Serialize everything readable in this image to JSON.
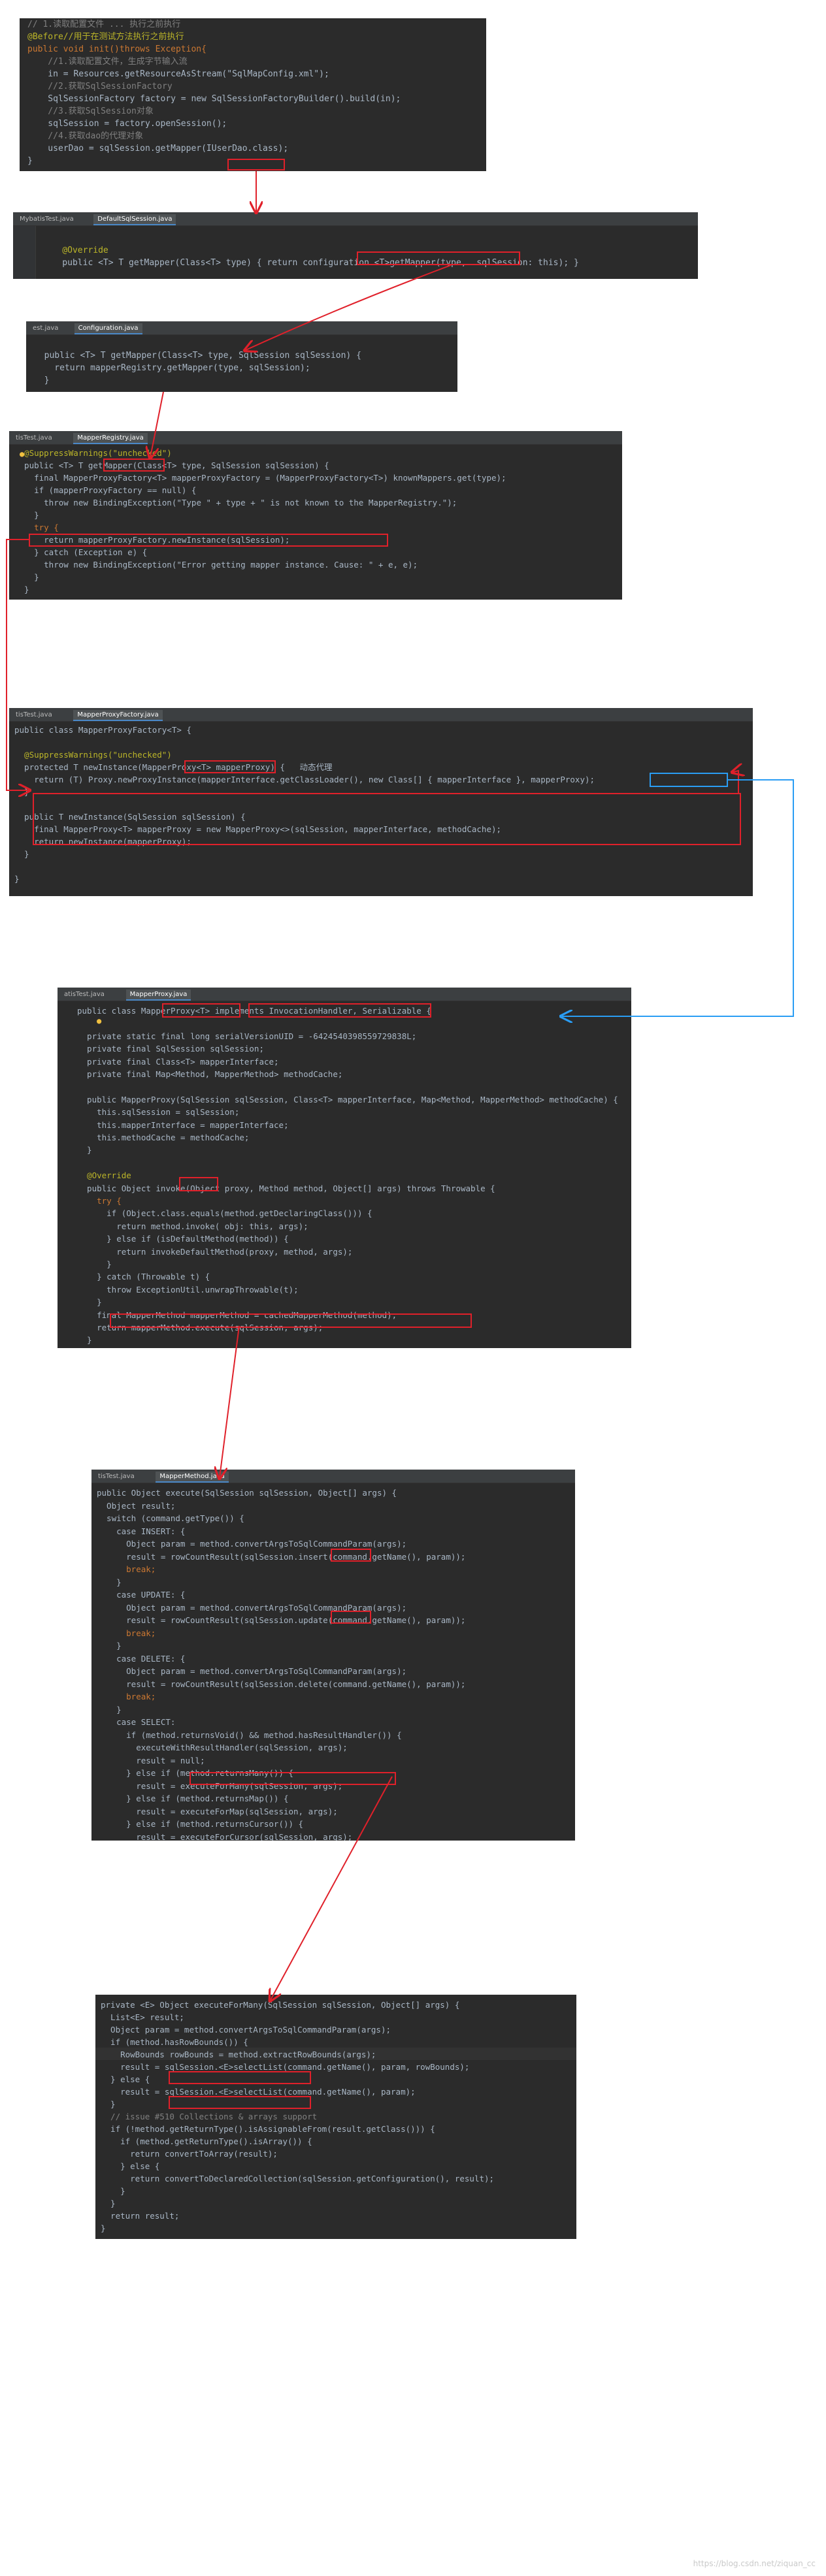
{
  "panels": [
    {
      "id": "p1",
      "tabs": [],
      "lines": [
        {
          "text": "// 1.读取配置文件 ... 执行之前执行",
          "color": "#808080"
        },
        {
          "text": "@Before//用于在测试方法执行之前执行",
          "color": "#bbb529"
        },
        {
          "text": "public void init()throws Exception{",
          "color": "#cc7832"
        },
        {
          "text": "    //1.读取配置文件，生成字节输入流",
          "color": "#808080"
        },
        {
          "text": "    in = Resources.getResourceAsStream(\"SqlMapConfig.xml\");",
          "color": "#a9b7c6"
        },
        {
          "text": "    //2.获取SqlSessionFactory",
          "color": "#808080"
        },
        {
          "text": "    SqlSessionFactory factory = new SqlSessionFactoryBuilder().build(in);",
          "color": "#a9b7c6"
        },
        {
          "text": "    //3.获取SqlSession对象",
          "color": "#808080"
        },
        {
          "text": "    sqlSession = factory.openSession();",
          "color": "#a9b7c6"
        },
        {
          "text": "    //4.获取dao的代理对象",
          "color": "#808080"
        },
        {
          "text": "    userDao = sqlSession.getMapper(IUserDao.class);",
          "color": "#a9b7c6"
        },
        {
          "text": "}",
          "color": "#a9b7c6"
        }
      ]
    },
    {
      "id": "p2",
      "tabs": [
        "MybatisTest.java",
        "DefaultSqlSession.java"
      ],
      "lines": [
        {
          "text": "",
          "color": "#a9b7c6"
        },
        {
          "text": "    @Override",
          "color": "#bbb529"
        },
        {
          "text": "    public <T> T getMapper(Class<T> type) { return configuration.<T>getMapper(type,  sqlSession: this); }",
          "color": "#a9b7c6"
        },
        {
          "text": "",
          "color": "#a9b7c6"
        }
      ]
    },
    {
      "id": "p3",
      "tabs": [
        "est.java",
        "Configuration.java"
      ],
      "lines": [
        {
          "text": "",
          "color": "#a9b7c6"
        },
        {
          "text": "  public <T> T getMapper(Class<T> type, SqlSession sqlSession) {",
          "color": "#a9b7c6"
        },
        {
          "text": "    return mapperRegistry.getMapper(type, sqlSession);",
          "color": "#a9b7c6"
        },
        {
          "text": "  }",
          "color": "#a9b7c6"
        }
      ]
    },
    {
      "id": "p4",
      "tabs": [
        "tisTest.java",
        "MapperRegistry.java"
      ],
      "lines": [
        {
          "text": "  @SuppressWarnings(\"unchecked\")",
          "color": "#bbb529"
        },
        {
          "text": "  public <T> T getMapper(Class<T> type, SqlSession sqlSession) {",
          "color": "#a9b7c6"
        },
        {
          "text": "    final MapperProxyFactory<T> mapperProxyFactory = (MapperProxyFactory<T>) knownMappers.get(type);",
          "color": "#a9b7c6"
        },
        {
          "text": "    if (mapperProxyFactory == null) {",
          "color": "#a9b7c6"
        },
        {
          "text": "      throw new BindingException(\"Type \" + type + \" is not known to the MapperRegistry.\");",
          "color": "#a9b7c6"
        },
        {
          "text": "    }",
          "color": "#a9b7c6"
        },
        {
          "text": "    try {",
          "color": "#cc7832"
        },
        {
          "text": "      return mapperProxyFactory.newInstance(sqlSession);",
          "color": "#a9b7c6"
        },
        {
          "text": "    } catch (Exception e) {",
          "color": "#a9b7c6"
        },
        {
          "text": "      throw new BindingException(\"Error getting mapper instance. Cause: \" + e, e);",
          "color": "#a9b7c6"
        },
        {
          "text": "    }",
          "color": "#a9b7c6"
        },
        {
          "text": "  }",
          "color": "#a9b7c6"
        }
      ]
    },
    {
      "id": "p5",
      "tabs": [
        "tisTest.java",
        "MapperProxyFactory.java"
      ],
      "lines": [
        {
          "text": "public class MapperProxyFactory<T> {",
          "color": "#a9b7c6"
        },
        {
          "text": "",
          "color": "#a9b7c6"
        },
        {
          "text": "  @SuppressWarnings(\"unchecked\")",
          "color": "#bbb529"
        },
        {
          "text": "  protected T newInstance(MapperProxy<T> mapperProxy) {   动态代理",
          "color": "#a9b7c6"
        },
        {
          "text": "    return (T) Proxy.newProxyInstance(mapperInterface.getClassLoader(), new Class[] { mapperInterface }, mapperProxy);",
          "color": "#a9b7c6"
        },
        {
          "text": "  }",
          "color": "#a9b7c6"
        },
        {
          "text": "",
          "color": "#a9b7c6"
        },
        {
          "text": "  public T newInstance(SqlSession sqlSession) {",
          "color": "#a9b7c6"
        },
        {
          "text": "    final MapperProxy<T> mapperProxy = new MapperProxy<>(sqlSession, mapperInterface, methodCache);",
          "color": "#a9b7c6"
        },
        {
          "text": "    return newInstance(mapperProxy);",
          "color": "#a9b7c6"
        },
        {
          "text": "  }",
          "color": "#a9b7c6"
        },
        {
          "text": "",
          "color": "#a9b7c6"
        },
        {
          "text": "}",
          "color": "#a9b7c6"
        }
      ]
    },
    {
      "id": "p6",
      "tabs": [
        "atisTest.java",
        "MapperProxy.java"
      ],
      "lines": [
        {
          "text": "public class MapperProxy<T> implements InvocationHandler, Serializable {",
          "color": "#a9b7c6"
        },
        {
          "text": "",
          "color": "#a9b7c6"
        },
        {
          "text": "  private static final long serialVersionUID = -6424540398559729838L;",
          "color": "#a9b7c6"
        },
        {
          "text": "  private final SqlSession sqlSession;",
          "color": "#a9b7c6"
        },
        {
          "text": "  private final Class<T> mapperInterface;",
          "color": "#a9b7c6"
        },
        {
          "text": "  private final Map<Method, MapperMethod> methodCache;",
          "color": "#a9b7c6"
        },
        {
          "text": "",
          "color": "#a9b7c6"
        },
        {
          "text": "  public MapperProxy(SqlSession sqlSession, Class<T> mapperInterface, Map<Method, MapperMethod> methodCache) {",
          "color": "#a9b7c6"
        },
        {
          "text": "    this.sqlSession = sqlSession;",
          "color": "#a9b7c6"
        },
        {
          "text": "    this.mapperInterface = mapperInterface;",
          "color": "#a9b7c6"
        },
        {
          "text": "    this.methodCache = methodCache;",
          "color": "#a9b7c6"
        },
        {
          "text": "  }",
          "color": "#a9b7c6"
        },
        {
          "text": "",
          "color": "#a9b7c6"
        },
        {
          "text": "  @Override",
          "color": "#bbb529"
        },
        {
          "text": "  public Object invoke(Object proxy, Method method, Object[] args) throws Throwable {",
          "color": "#a9b7c6"
        },
        {
          "text": "    try {",
          "color": "#cc7832"
        },
        {
          "text": "      if (Object.class.equals(method.getDeclaringClass())) {",
          "color": "#a9b7c6"
        },
        {
          "text": "        return method.invoke( obj: this, args);",
          "color": "#a9b7c6"
        },
        {
          "text": "      } else if (isDefaultMethod(method)) {",
          "color": "#a9b7c6"
        },
        {
          "text": "        return invokeDefaultMethod(proxy, method, args);",
          "color": "#a9b7c6"
        },
        {
          "text": "      }",
          "color": "#a9b7c6"
        },
        {
          "text": "    } catch (Throwable t) {",
          "color": "#a9b7c6"
        },
        {
          "text": "      throw ExceptionUtil.unwrapThrowable(t);",
          "color": "#a9b7c6"
        },
        {
          "text": "    }",
          "color": "#a9b7c6"
        },
        {
          "text": "    final MapperMethod mapperMethod = cachedMapperMethod(method);",
          "color": "#a9b7c6"
        },
        {
          "text": "    return mapperMethod.execute(sqlSession, args);",
          "color": "#a9b7c6"
        },
        {
          "text": "  }",
          "color": "#a9b7c6"
        }
      ]
    },
    {
      "id": "p7",
      "tabs": [
        "tisTest.java",
        "MapperMethod.java"
      ],
      "lines": [
        {
          "text": "public Object execute(SqlSession sqlSession, Object[] args) {",
          "color": "#a9b7c6"
        },
        {
          "text": "  Object result;",
          "color": "#a9b7c6"
        },
        {
          "text": "  switch (command.getType()) {",
          "color": "#a9b7c6"
        },
        {
          "text": "    case INSERT: {",
          "color": "#a9b7c6"
        },
        {
          "text": "      Object param = method.convertArgsToSqlCommandParam(args);",
          "color": "#a9b7c6"
        },
        {
          "text": "      result = rowCountResult(sqlSession.insert(command.getName(), param));",
          "color": "#a9b7c6"
        },
        {
          "text": "      break;",
          "color": "#cc7832"
        },
        {
          "text": "    }",
          "color": "#a9b7c6"
        },
        {
          "text": "    case UPDATE: {",
          "color": "#a9b7c6"
        },
        {
          "text": "      Object param = method.convertArgsToSqlCommandParam(args);",
          "color": "#a9b7c6"
        },
        {
          "text": "      result = rowCountResult(sqlSession.update(command.getName(), param));",
          "color": "#a9b7c6"
        },
        {
          "text": "      break;",
          "color": "#cc7832"
        },
        {
          "text": "    }",
          "color": "#a9b7c6"
        },
        {
          "text": "    case DELETE: {",
          "color": "#a9b7c6"
        },
        {
          "text": "      Object param = method.convertArgsToSqlCommandParam(args);",
          "color": "#a9b7c6"
        },
        {
          "text": "      result = rowCountResult(sqlSession.delete(command.getName(), param));",
          "color": "#a9b7c6"
        },
        {
          "text": "      break;",
          "color": "#cc7832"
        },
        {
          "text": "    }",
          "color": "#a9b7c6"
        },
        {
          "text": "    case SELECT:",
          "color": "#a9b7c6"
        },
        {
          "text": "      if (method.returnsVoid() && method.hasResultHandler()) {",
          "color": "#a9b7c6"
        },
        {
          "text": "        executeWithResultHandler(sqlSession, args);",
          "color": "#a9b7c6"
        },
        {
          "text": "        result = null;",
          "color": "#a9b7c6"
        },
        {
          "text": "      } else if (method.returnsMany()) {",
          "color": "#a9b7c6"
        },
        {
          "text": "        result = executeForMany(sqlSession, args);",
          "color": "#a9b7c6"
        },
        {
          "text": "      } else if (method.returnsMap()) {",
          "color": "#a9b7c6"
        },
        {
          "text": "        result = executeForMap(sqlSession, args);",
          "color": "#a9b7c6"
        },
        {
          "text": "      } else if (method.returnsCursor()) {",
          "color": "#a9b7c6"
        },
        {
          "text": "        result = executeForCursor(sqlSession, args);",
          "color": "#a9b7c6"
        }
      ]
    },
    {
      "id": "p8",
      "tabs": [],
      "lines": [
        {
          "text": "private <E> Object executeForMany(SqlSession sqlSession, Object[] args) {",
          "color": "#a9b7c6"
        },
        {
          "text": "  List<E> result;",
          "color": "#a9b7c6"
        },
        {
          "text": "  Object param = method.convertArgsToSqlCommandParam(args);",
          "color": "#a9b7c6"
        },
        {
          "text": "  if (method.hasRowBounds()) {",
          "color": "#a9b7c6"
        },
        {
          "text": "    RowBounds rowBounds = method.extractRowBounds(args);",
          "color": "#a9b7c6"
        },
        {
          "text": "    result = sqlSession.<E>selectList(command.getName(), param, rowBounds);",
          "color": "#a9b7c6"
        },
        {
          "text": "  } else {",
          "color": "#a9b7c6"
        },
        {
          "text": "    result = sqlSession.<E>selectList(command.getName(), param);",
          "color": "#a9b7c6"
        },
        {
          "text": "  }",
          "color": "#a9b7c6"
        },
        {
          "text": "  // issue #510 Collections & arrays support",
          "color": "#808080"
        },
        {
          "text": "  if (!method.getReturnType().isAssignableFrom(result.getClass())) {",
          "color": "#a9b7c6"
        },
        {
          "text": "    if (method.getReturnType().isArray()) {",
          "color": "#a9b7c6"
        },
        {
          "text": "      return convertToArray(result);",
          "color": "#a9b7c6"
        },
        {
          "text": "    } else {",
          "color": "#a9b7c6"
        },
        {
          "text": "      return convertToDeclaredCollection(sqlSession.getConfiguration(), result);",
          "color": "#a9b7c6"
        },
        {
          "text": "    }",
          "color": "#a9b7c6"
        },
        {
          "text": "  }",
          "color": "#a9b7c6"
        },
        {
          "text": "  return result;",
          "color": "#a9b7c6"
        },
        {
          "text": "}",
          "color": "#a9b7c6"
        }
      ]
    }
  ],
  "watermark": "https://blog.csdn.net/ziquan_cc",
  "colors": {
    "highlight_box": "#e0202a",
    "blue_box": "#2a9df4",
    "editor_bg": "#2b2b2b"
  }
}
